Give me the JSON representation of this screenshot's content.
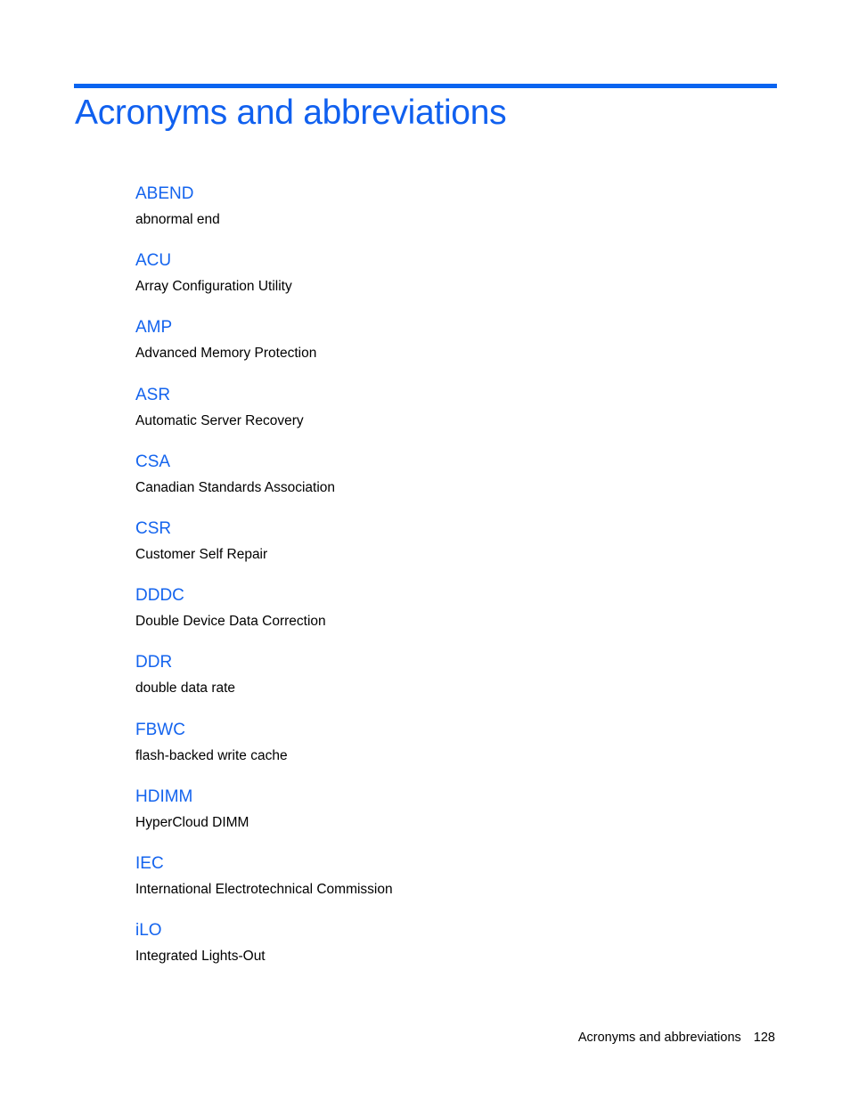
{
  "page": {
    "title": "Acronyms and abbreviations",
    "accent_color": "#0a64f0"
  },
  "entries": [
    {
      "term": "ABEND",
      "definition": "abnormal end"
    },
    {
      "term": "ACU",
      "definition": "Array Configuration Utility"
    },
    {
      "term": "AMP",
      "definition": "Advanced Memory Protection"
    },
    {
      "term": "ASR",
      "definition": "Automatic Server Recovery"
    },
    {
      "term": "CSA",
      "definition": "Canadian Standards Association"
    },
    {
      "term": "CSR",
      "definition": "Customer Self Repair"
    },
    {
      "term": "DDDC",
      "definition": "Double Device Data Correction"
    },
    {
      "term": "DDR",
      "definition": "double data rate"
    },
    {
      "term": "FBWC",
      "definition": "flash-backed write cache"
    },
    {
      "term": "HDIMM",
      "definition": "HyperCloud DIMM"
    },
    {
      "term": "IEC",
      "definition": "International Electrotechnical Commission"
    },
    {
      "term": "iLO",
      "definition": "Integrated Lights-Out"
    }
  ],
  "footer": {
    "section": "Acronyms and abbreviations",
    "page_number": "128"
  }
}
